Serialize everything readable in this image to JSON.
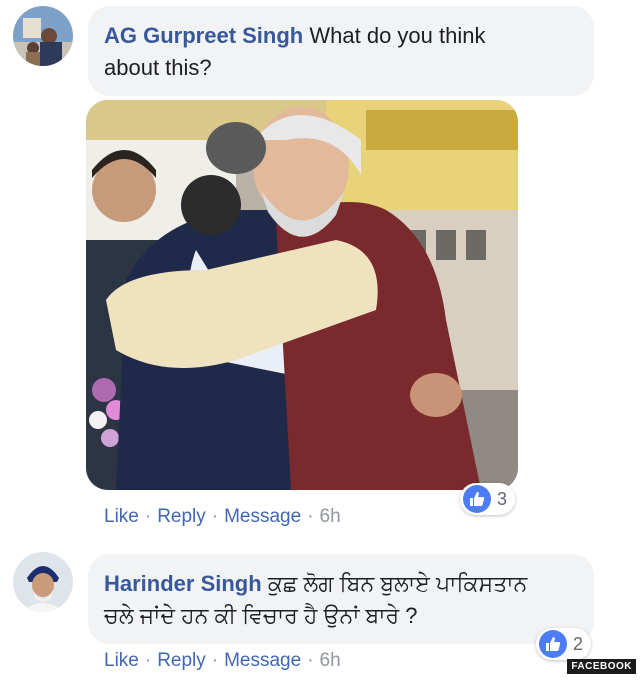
{
  "comments": [
    {
      "author": "AG Gurpreet Singh",
      "text_line1": "What do you think",
      "text_line2": "about this?",
      "actions": {
        "like": "Like",
        "reply": "Reply",
        "message": "Message",
        "time": "6h"
      },
      "reactions": {
        "icon": "like-thumb-icon",
        "count": "3"
      }
    },
    {
      "author": "Harinder Singh",
      "text_line1": "ਕੁਛ ਲੋਗ ਬਿਨ ਬੁਲਾਏ ਪਾਕਿਸਤਾਨ",
      "text_line2": "ਚਲੇ ਜਾਂਦੇ ਹਨ ਕੀ ਵਿਚਾਰ ਹੈ ਉਨਾਂ ਬਾਰੇ ?",
      "actions": {
        "like": "Like",
        "reply": "Reply",
        "message": "Message",
        "time": "6h"
      },
      "reactions": {
        "icon": "like-thumb-icon",
        "count": "2"
      }
    }
  ],
  "separator": "·",
  "watermark": "FACEBOOK",
  "colors": {
    "author": "#385898",
    "bubble": "#f2f3f5",
    "link": "#4267b2",
    "like_blue": "#4c7cf6"
  }
}
